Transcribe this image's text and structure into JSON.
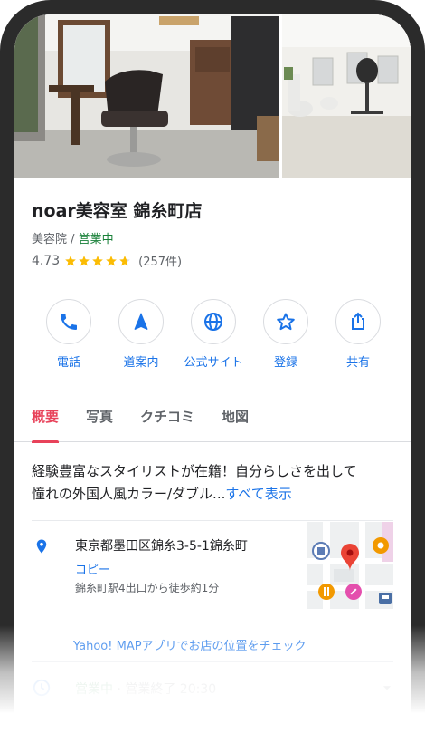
{
  "business": {
    "name": "noar美容室 錦糸町店",
    "category": "美容院",
    "separator": " / ",
    "status": "営業中",
    "rating": "4.73",
    "rating_value": 4.73,
    "review_count": "(257件)"
  },
  "actions": [
    {
      "label": "電話",
      "icon": "phone-icon"
    },
    {
      "label": "道案内",
      "icon": "navigation-arrow-icon"
    },
    {
      "label": "公式サイト",
      "icon": "globe-icon"
    },
    {
      "label": "登録",
      "icon": "star-outline-icon"
    },
    {
      "label": "共有",
      "icon": "share-icon"
    }
  ],
  "tabs": [
    {
      "label": "概要",
      "active": true
    },
    {
      "label": "写真",
      "active": false
    },
    {
      "label": "クチコミ",
      "active": false
    },
    {
      "label": "地図",
      "active": false
    }
  ],
  "description": {
    "line1": "経験豊富なスタイリストが在籍！自分らしさを出して",
    "line2": "憧れの外国人風カラー/ダブル...",
    "more": "すべて表示"
  },
  "address": {
    "text": "東京都墨田区錦糸3-5-1錦糸町",
    "copy": "コピー",
    "access": "錦糸町駅4出口から徒歩約1分"
  },
  "yahoo_link": "Yahoo! MAPアプリでお店の位置をチェック",
  "hours": {
    "status": "営業中",
    "dot": " · ",
    "closing": "営業終了 20:30"
  },
  "colors": {
    "accent": "#e8425a",
    "link": "#1a73e8",
    "open": "#188038",
    "star": "#fbbc04"
  }
}
